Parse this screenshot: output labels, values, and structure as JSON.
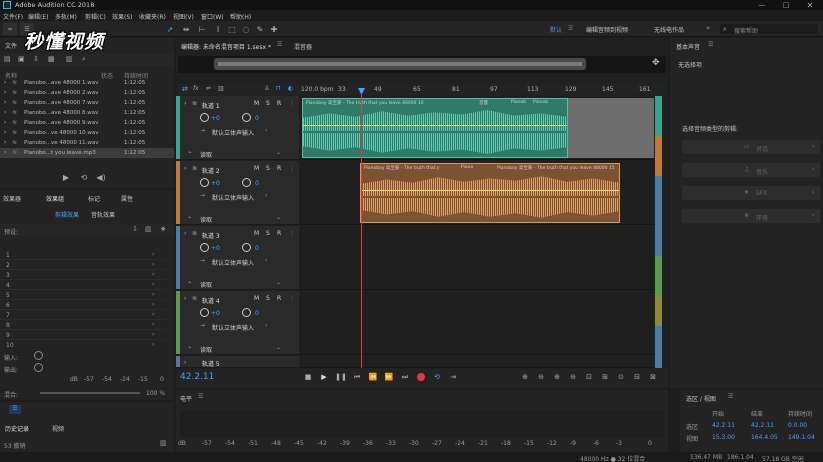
{
  "app": {
    "title": "Adobe Audition CC 2018"
  },
  "menu": [
    "文件(F)",
    "编辑(E)",
    "多轨(M)",
    "剪辑(C)",
    "效果(S)",
    "收藏夹(R)",
    "视图(V)",
    "窗口(W)",
    "帮助(H)"
  ],
  "watermark": "秒懂视频",
  "toolbar": {
    "workspaces": [
      "默认",
      "编辑音频到视频",
      "无线电作品"
    ],
    "search_placeholder": "搜索帮助"
  },
  "files_panel": {
    "title": "文件",
    "columns": [
      "名称",
      "状态",
      "持续时间"
    ],
    "files": [
      {
        "name": "Pianobo...ave 48000 1.wav",
        "duration": "1:12:05"
      },
      {
        "name": "Pianobo...ave 48000 2.wav",
        "duration": "1:12:05"
      },
      {
        "name": "Pianobo...ave 48000 7.wav",
        "duration": "1:12:05"
      },
      {
        "name": "Pianobo...ave 48000 8.wav",
        "duration": "1:12:05"
      },
      {
        "name": "Pianobo...ave 48000 9.wav",
        "duration": "1:12:05"
      },
      {
        "name": "Pianobo...ve 48000 10.wav",
        "duration": "1:12:05"
      },
      {
        "name": "Pianobo...ve 48000 11.wav",
        "duration": "1:12:05"
      },
      {
        "name": "Pianobo...t you leave.mp3",
        "duration": "1:12:05"
      }
    ]
  },
  "effects_panel": {
    "tabs": [
      "效果器",
      "效果组",
      "标记",
      "属性"
    ],
    "subtabs": [
      "剪辑效果",
      "音轨效果"
    ],
    "preset_label": "预设:",
    "ticks": [
      "dB",
      "-57",
      "-54",
      "-24",
      "-15",
      "0"
    ],
    "rows": [
      "1",
      "2",
      "3",
      "4",
      "5",
      "6",
      "7",
      "8",
      "9",
      "10"
    ],
    "mix_labels": [
      "输入:",
      "输出:",
      "混合:"
    ],
    "mix_value": "100 %"
  },
  "history_panel": {
    "tabs": [
      "历史记录",
      "视频"
    ],
    "count": "53 撤销"
  },
  "editor": {
    "title": "编辑器: 未命名混音项目 1.sesx *",
    "tab2": "混音器",
    "timecode": "42.2.11",
    "ruler": [
      "120.0 bpm",
      "33",
      "49",
      "65",
      "81",
      "97",
      "113",
      "129",
      "145",
      "161"
    ],
    "tracks": [
      {
        "name": "轨道 1",
        "vol": "+0",
        "pan": "0",
        "input": "默认立体声输入",
        "mode": "读取",
        "color": "#3aa58e"
      },
      {
        "name": "轨道 2",
        "vol": "+0",
        "pan": "0",
        "input": "默认立体声输入",
        "mode": "读取",
        "color": "#c07a3b"
      },
      {
        "name": "轨道 3",
        "vol": "+0",
        "pan": "0",
        "input": "默认立体声输入",
        "mode": "读取",
        "color": "#4a7ea8"
      },
      {
        "name": "轨道 4",
        "vol": "+0",
        "pan": "0",
        "input": "默认立体声输入",
        "mode": "读取",
        "color": "#5d9a4d"
      },
      {
        "name": "轨道 5",
        "vol": "",
        "pan": "",
        "input": "",
        "mode": "",
        "color": "#6b6b9c"
      }
    ],
    "clips": [
      {
        "label": "Pianoboy 高至豪 - The truth that you leave 48000 10"
      },
      {
        "label": "音量"
      },
      {
        "label": "Pianob"
      },
      {
        "label": "Pianob"
      },
      {
        "label": "Pianoboy 高至豪 - The truth that y"
      },
      {
        "label": "Piano"
      },
      {
        "label": "Pianoboy 高至豪 - The truth that you leave 48000 15"
      }
    ],
    "msr": [
      "M",
      "S",
      "R"
    ],
    "lane_colors": [
      "#3aa58e",
      "#c07a3b",
      "#4a7ea8",
      "#5d9a4d",
      "#8b8b3a",
      "#6b6b9c"
    ]
  },
  "levels_panel": {
    "title": "电平",
    "ticks": [
      "dB",
      "-57",
      "-54",
      "-51",
      "-48",
      "-45",
      "-42",
      "-39",
      "-36",
      "-33",
      "-30",
      "-27",
      "-24",
      "-21",
      "-18",
      "-15",
      "-12",
      "-9",
      "-6",
      "-3",
      "0"
    ]
  },
  "essential_sound": {
    "title": "基本声音",
    "no_selection": "无选择项",
    "prompt": "选择音频类型的剪辑:",
    "types": [
      "对话",
      "音乐",
      "SFX",
      "环境"
    ]
  },
  "selection_view": {
    "title": "选区 / 视图",
    "headers": [
      "开始",
      "结束",
      "持续时间"
    ],
    "rows": [
      {
        "label": "选区",
        "start": "42.2.11",
        "end": "42.2.11",
        "dur": "0.0.00"
      },
      {
        "label": "视图",
        "start": "15.3.00",
        "end": "164.4.05",
        "dur": "149.1.04"
      }
    ]
  },
  "status": {
    "sample": "48000 Hz ● 32 位混合",
    "size1": "136.47 MB",
    "time": "186.1.04",
    "free": "57.18 GB 空闲"
  }
}
